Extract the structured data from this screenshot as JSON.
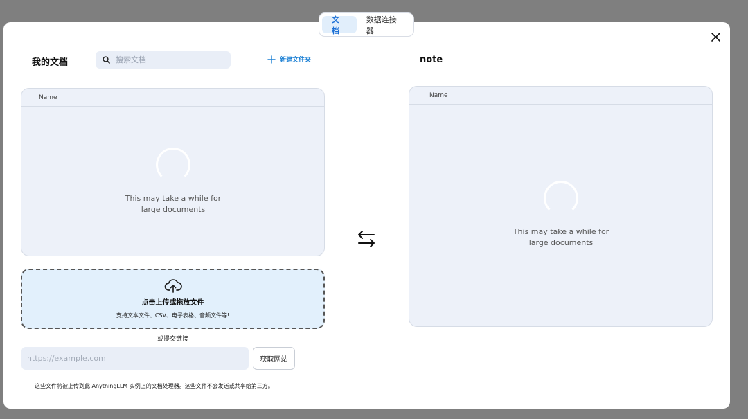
{
  "tabs": [
    {
      "label": "文档",
      "active": true
    },
    {
      "label": "数据连接器",
      "active": false
    }
  ],
  "left": {
    "title": "我的文档",
    "search_placeholder": "搜索文档",
    "new_folder_label": "新建文件夹",
    "column_name": "Name",
    "loading_line1": "This may take a while for",
    "loading_line2": "large documents"
  },
  "upload": {
    "title": "点击上传或拖放文件",
    "subtitle": "支持文本文件、CSV、电子表格、音频文件等!",
    "or_link": "或提交链接",
    "url_placeholder": "https://example.com",
    "fetch_label": "获取网站",
    "footer_note": "这些文件将被上传到此 AnythingLLM 实例上的文档处理器。这些文件不会发送或共享给第三方。"
  },
  "right": {
    "title": "note",
    "column_name": "Name",
    "loading_line1": "This may take a while for",
    "loading_line2": "large documents"
  },
  "colors": {
    "accent": "#1a7fd4",
    "panel_bg": "#edf1f9",
    "upload_bg": "#e2f0fc",
    "overlay": "#7f7f7f"
  },
  "icons": [
    "close-icon",
    "search-icon",
    "plus-icon",
    "swap-arrows-icon",
    "cloud-upload-icon",
    "loading-spinner-icon"
  ]
}
